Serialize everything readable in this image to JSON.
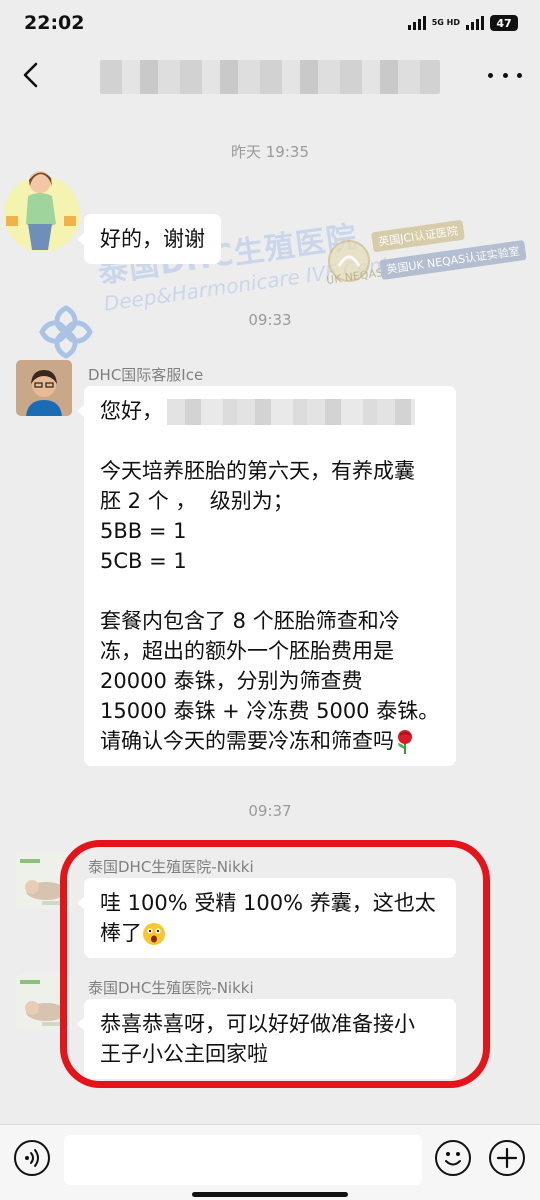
{
  "status_bar": {
    "time": "22:02",
    "network": "5G HD",
    "battery": "47"
  },
  "nav": {
    "title": ""
  },
  "messages": [
    {
      "type": "timestamp",
      "text": "昨天 19:35"
    },
    {
      "type": "message",
      "sender": "",
      "text": "好的，谢谢"
    },
    {
      "type": "timestamp",
      "text": "09:33"
    },
    {
      "type": "message",
      "sender": "DHC国际客服Ice",
      "greeting": "您好，",
      "text": "今天培养胚胎的第六天，有养成囊\n胚 2 个 ，  级别为；\n5BB = 1\n5CB = 1\n\n套餐内包含了 8 个胚胎筛查和冷\n冻，超出的额外一个胚胎费用是\n20000 泰铢，分别为筛查费\n15000 泰铢 + 冷冻费 5000 泰铢。\n请确认今天的需要冷冻和筛查吗",
      "emoji": "rose"
    },
    {
      "type": "timestamp",
      "text": "09:37"
    },
    {
      "type": "message",
      "sender": "泰国DHC生殖医院-Nikki",
      "text": "哇 100% 受精 100% 养囊，这也太\n棒了",
      "emoji": "surprised-face"
    },
    {
      "type": "message",
      "sender": "泰国DHC生殖医院-Nikki",
      "text": "恭喜恭喜呀，可以好好做准备接小\n王子小公主回家啦"
    }
  ],
  "watermark": {
    "brand": "泰国DHC生殖医院",
    "sub": "Deep&Harmonicare IVF Center",
    "neqas": "UK NEQAS",
    "jci": "英国JCI认证医院",
    "uk_neqas": "英国UK NEQAS认证实验室"
  },
  "input": {
    "placeholder": ""
  },
  "colors": {
    "background": "#ededed",
    "bubble": "#ffffff",
    "highlight": "#e5131a",
    "watermark": "#bfd0ea"
  }
}
